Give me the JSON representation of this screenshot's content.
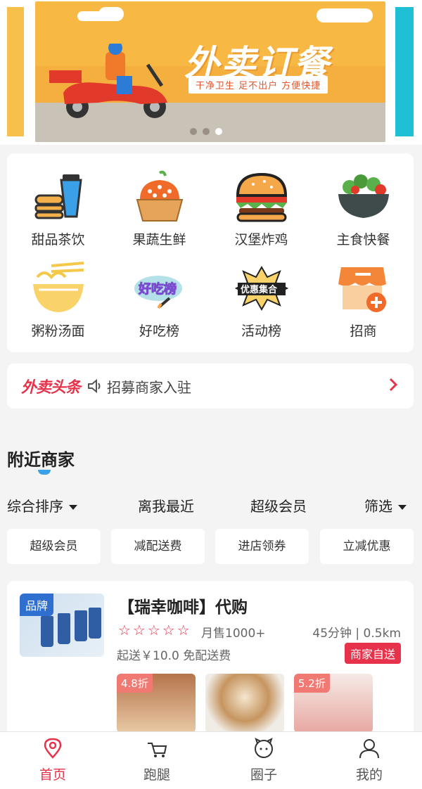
{
  "banner": {
    "title": "外卖订餐",
    "subtitle": "干净卫生 足不出户 方便快捷",
    "indicator_count": 3,
    "active_index": 2
  },
  "categories": [
    {
      "label": "甜品茶饮",
      "icon": "drink-burger-icon"
    },
    {
      "label": "果蔬生鲜",
      "icon": "fruit-basket-icon"
    },
    {
      "label": "汉堡炸鸡",
      "icon": "burger-icon"
    },
    {
      "label": "主食快餐",
      "icon": "salad-bowl-icon"
    },
    {
      "label": "粥粉汤面",
      "icon": "noodle-bowl-icon"
    },
    {
      "label": "好吃榜",
      "icon": "tasty-ranking-icon",
      "badge_text": "好吃榜"
    },
    {
      "label": "活动榜",
      "icon": "promo-ranking-icon",
      "badge_text": "优惠集合"
    },
    {
      "label": "招商",
      "icon": "shop-add-icon"
    }
  ],
  "headline": {
    "logo": "外卖头条",
    "text": "招募商家入驻"
  },
  "nearby": {
    "title": "附近商家",
    "sort_options": [
      "综合排序",
      "离我最近",
      "超级会员",
      "筛选"
    ],
    "chips": [
      "超级会员",
      "减配送费",
      "进店领券",
      "立减优惠"
    ]
  },
  "shop": {
    "badge": "品牌",
    "name": "【瑞幸咖啡】代购",
    "stars": "☆☆☆☆☆",
    "monthly_sales": "月售1000+",
    "distance": "45分钟 | 0.5km",
    "fee": "起送￥10.0 免配送费",
    "delivery_tag": "商家自送",
    "dishes": [
      {
        "discount": "4.8折"
      },
      {
        "discount": ""
      },
      {
        "discount": "5.2折"
      }
    ]
  },
  "tabbar": [
    {
      "label": "首页",
      "icon": "location-pin-icon",
      "active": true
    },
    {
      "label": "跑腿",
      "icon": "cart-icon",
      "active": false
    },
    {
      "label": "圈子",
      "icon": "circle-face-icon",
      "active": false
    },
    {
      "label": "我的",
      "icon": "user-icon",
      "active": false
    }
  ],
  "colors": {
    "accent": "#e6324b",
    "banner_bg": "#f8b944",
    "brand_badge": "#2f6fd0"
  }
}
